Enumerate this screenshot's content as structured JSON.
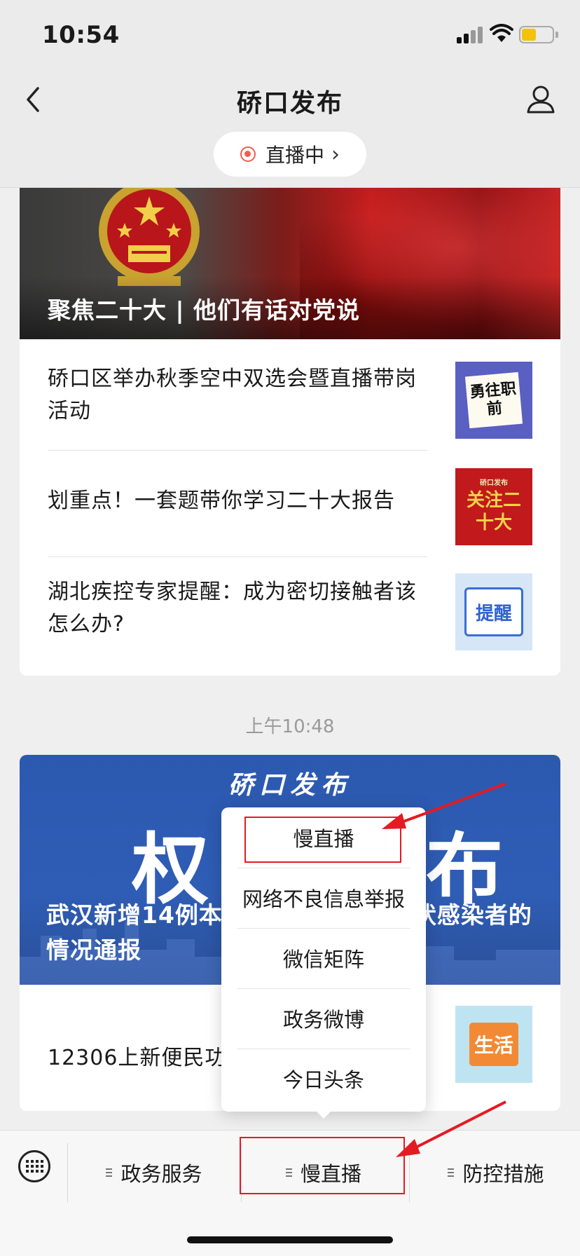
{
  "status_bar": {
    "time": "10:54"
  },
  "header": {
    "title": "硚口发布",
    "live_label": "直播中"
  },
  "feed": {
    "group1": {
      "banner_title": "聚焦二十大 | 他们有话对党说",
      "items": [
        {
          "title": "硚口区举办秋季空中双选会暨直播带岗活动",
          "thumb_text": "勇往职前"
        },
        {
          "title": "划重点！一套题带你学习二十大报告",
          "thumb_small": "硚口发布",
          "thumb_text": "关注二十大"
        },
        {
          "title": "湖北疾控专家提醒：成为密切接触者该怎么办?",
          "thumb_text": "提醒"
        }
      ]
    },
    "timestamp": "上午10:48",
    "group2": {
      "banner_brand": "硚口发布",
      "banner_big_left": "权",
      "banner_big_right": "布",
      "banner_title": "武汉新增14例本土确诊病例和无症状感染者的情况通报",
      "items": [
        {
          "title": "12306上新便民功能",
          "thumb_text": "生活"
        }
      ]
    }
  },
  "popup_menu": {
    "items": [
      "慢直播",
      "网络不良信息举报",
      "微信矩阵",
      "政务微博",
      "今日头条"
    ]
  },
  "bottom_menu": {
    "tabs": [
      "政务服务",
      "慢直播",
      "防控措施"
    ]
  },
  "colors": {
    "accent_red": "#e31b23",
    "live_red": "#f25d4e"
  },
  "icons": [
    "back-arrow-icon",
    "profile-icon",
    "live-dot-icon",
    "chevron-right-icon",
    "keyboard-icon",
    "menu-lines-icon"
  ]
}
